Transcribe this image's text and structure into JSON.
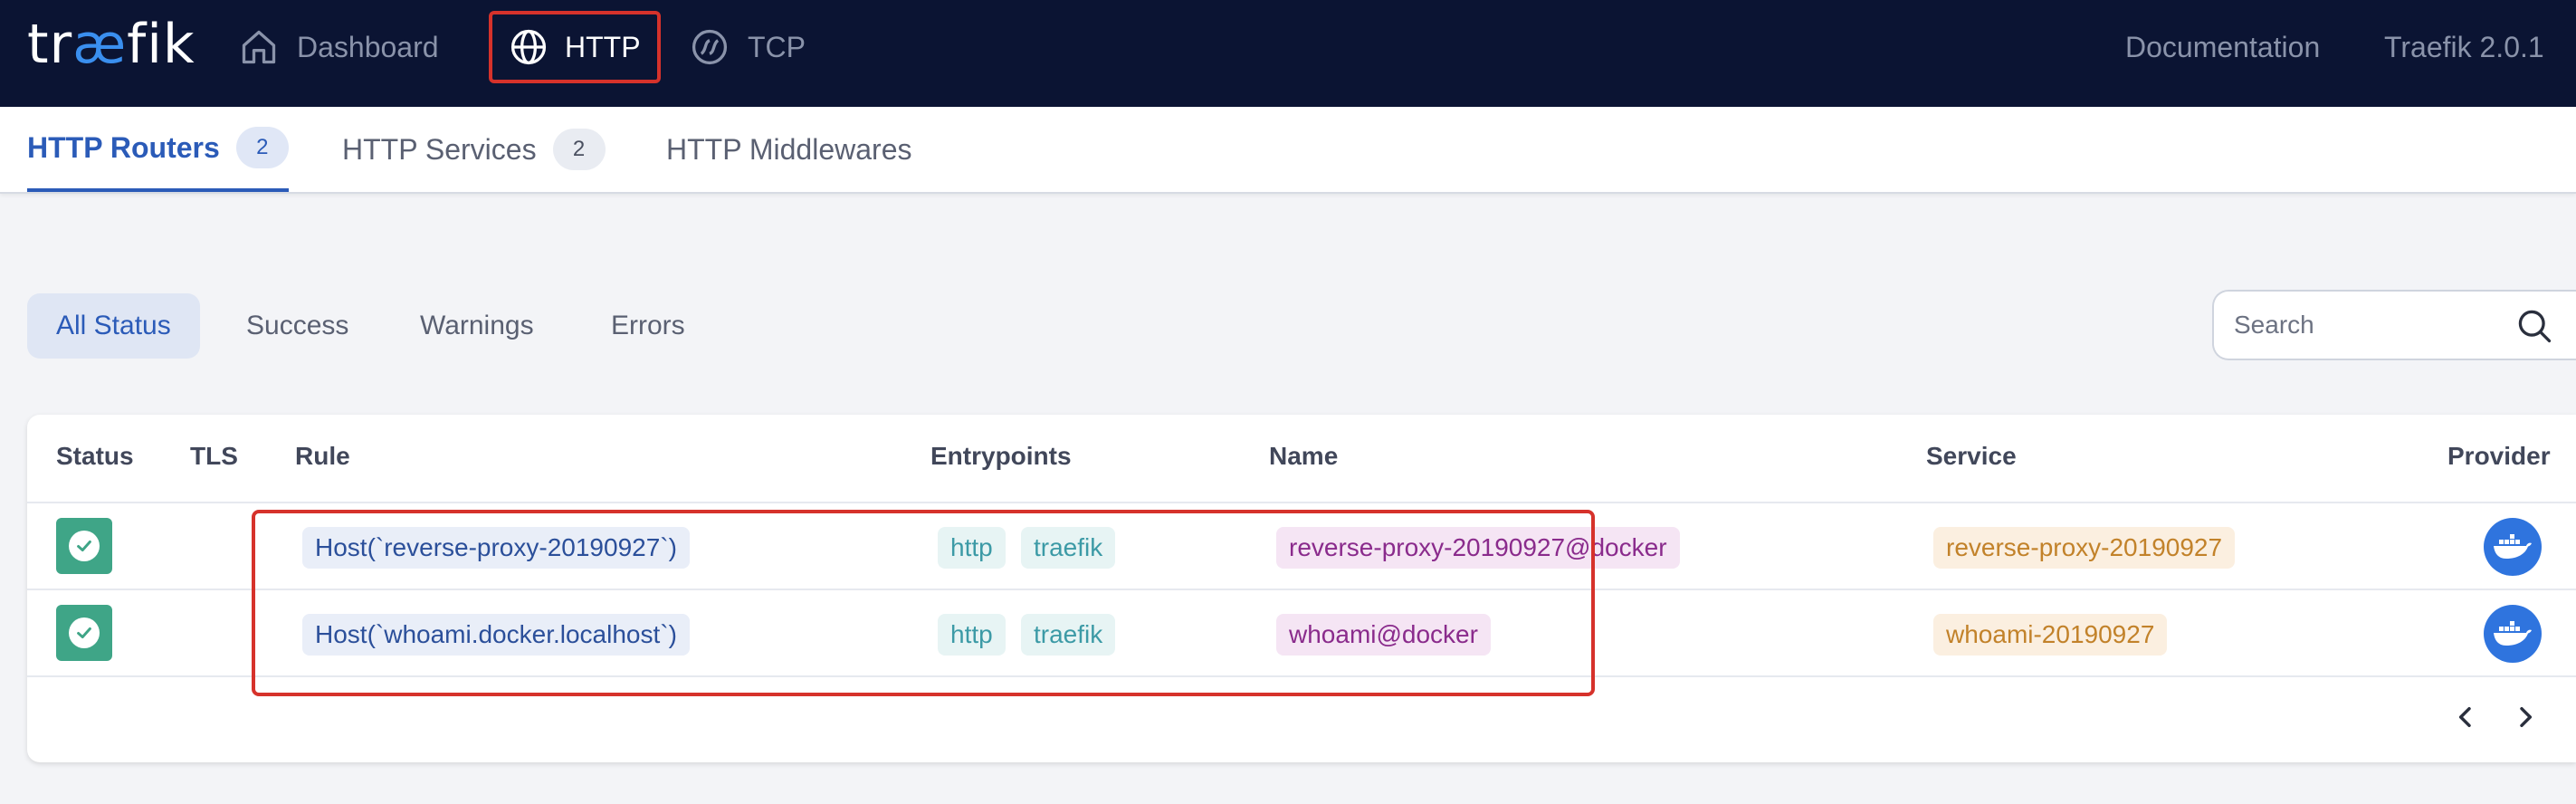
{
  "nav": {
    "logo": {
      "pre": "tr",
      "ae": "æ",
      "post": "fik"
    },
    "dashboard": "Dashboard",
    "http": "HTTP",
    "tcp": "TCP",
    "documentation": "Documentation",
    "version": "Traefik 2.0.1"
  },
  "subtabs": {
    "routers": {
      "label": "HTTP Routers",
      "count": "2"
    },
    "services": {
      "label": "HTTP Services",
      "count": "2"
    },
    "middlewares": {
      "label": "HTTP Middlewares"
    }
  },
  "filters": {
    "all": "All Status",
    "success": "Success",
    "warnings": "Warnings",
    "errors": "Errors",
    "active": "All Status"
  },
  "search": {
    "placeholder": "Search"
  },
  "table": {
    "headers": {
      "status": "Status",
      "tls": "TLS",
      "rule": "Rule",
      "entrypoints": "Entrypoints",
      "name": "Name",
      "service": "Service",
      "provider": "Provider"
    },
    "rows": [
      {
        "status": "success",
        "rule": "Host(`reverse-proxy-20190927`)",
        "entrypoints": [
          "http",
          "traefik"
        ],
        "name": "reverse-proxy-20190927@docker",
        "service": "reverse-proxy-20190927",
        "provider": "docker-icon"
      },
      {
        "status": "success",
        "rule": "Host(`whoami.docker.localhost`)",
        "entrypoints": [
          "http",
          "traefik"
        ],
        "name": "whoami@docker",
        "service": "whoami-20190927",
        "provider": "docker-icon"
      }
    ]
  },
  "pager": {
    "prev": "‹",
    "next": "›"
  },
  "colors": {
    "navbar": "#0b1433",
    "accent": "#2b5bb8",
    "highlight": "#d6322b",
    "success": "#3fa587",
    "provider": "#2f74de"
  }
}
